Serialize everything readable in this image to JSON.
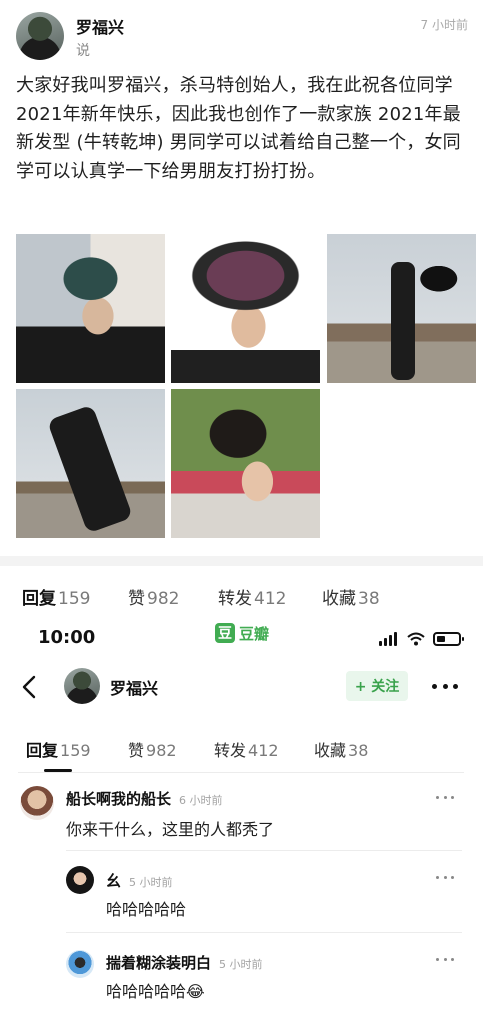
{
  "post": {
    "author": "罗福兴",
    "subtitle": "说",
    "time": "7 小时前",
    "body": "大家好我叫罗福兴，杀马特创始人，我在此祝各位同学 2021年新年快乐，因此我也创作了一款家族 2021年最新发型 (牛转乾坤) 男同学可以试着给自己整一个，女同学可以认真学一下给男朋友打扮打扮。",
    "photos": [
      "photo-1",
      "photo-2",
      "photo-3",
      "photo-4",
      "photo-5"
    ]
  },
  "stats": {
    "reply_label": "回复",
    "reply_count": "159",
    "like_label": "赞",
    "like_count": "982",
    "repost_label": "转发",
    "repost_count": "412",
    "fav_label": "收藏",
    "fav_count": "38"
  },
  "status_bar": {
    "time": "10:00",
    "app_logo": "豆",
    "app_name": "豆瓣",
    "icons": [
      "signal-icon",
      "wifi-icon",
      "battery-icon"
    ]
  },
  "nav": {
    "author": "罗福兴",
    "follow_label": "+ 关注",
    "icons": [
      "back-icon",
      "more-icon"
    ]
  },
  "tabs": {
    "reply_label": "回复",
    "reply_count": "159",
    "like_label": "赞",
    "like_count": "982",
    "repost_label": "转发",
    "repost_count": "412",
    "fav_label": "收藏",
    "fav_count": "38"
  },
  "comments": [
    {
      "name": "船长啊我的船长",
      "time": "6 小时前",
      "text": "你来干什么，这里的人都秃了"
    },
    {
      "name": "幺",
      "time": "5 小时前",
      "text": "哈哈哈哈哈"
    },
    {
      "name": "揣着糊涂装明白",
      "time": "5 小时前",
      "text": "哈哈哈哈哈😂"
    }
  ],
  "colors": {
    "brand_green": "#41ac52",
    "follow_bg": "#e9f6ec",
    "muted_text": "#a3a3a3"
  }
}
